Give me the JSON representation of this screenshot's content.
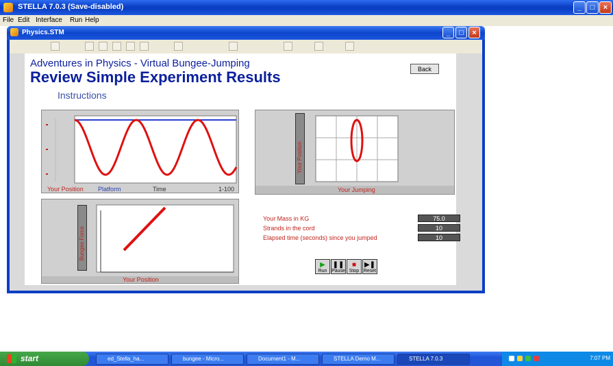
{
  "window": {
    "title": "STELLA 7.0.3 (Save-disabled)"
  },
  "menubar": {
    "items": [
      "File",
      "Edit",
      "Interface",
      "Run",
      "Help"
    ]
  },
  "inner_window": {
    "title": "Physics.STM"
  },
  "page": {
    "subtitle": "Adventures in Physics - Virtual Bungee-Jumping",
    "title": "Review Simple Experiment Results",
    "instructions_link": "Instructions",
    "back_button": "Back"
  },
  "graph1": {
    "legend": [
      "Your Position",
      "Platform",
      "Time",
      "1-100"
    ]
  },
  "graph2": {
    "footer": "Your Jumping",
    "ylabel": "Your Position"
  },
  "graph3": {
    "footer": "Your Position",
    "ylabel": "Bungee Force"
  },
  "stats": {
    "rows": [
      {
        "label": "Your Mass in KG",
        "value": "75.0"
      },
      {
        "label": "Strands in the cord",
        "value": "10"
      },
      {
        "label": "Elapsed time (seconds) since you jumped",
        "value": "10"
      }
    ]
  },
  "controls": {
    "run": "Run",
    "pause": "Pause",
    "stop": "Stop",
    "reset": "Reset"
  },
  "taskbar": {
    "start": "start",
    "tasks": [
      "ed_Stella_ha...",
      "bungee - Micro...",
      "Document1 - M...",
      "STELLA Demo M...",
      "STELLA 7.0.3"
    ],
    "tray_text": "7:07 PM"
  },
  "colors": {
    "title_blue": "#0b1f9c",
    "curve_red": "#e01010",
    "platform_blue": "#2a40d0"
  }
}
